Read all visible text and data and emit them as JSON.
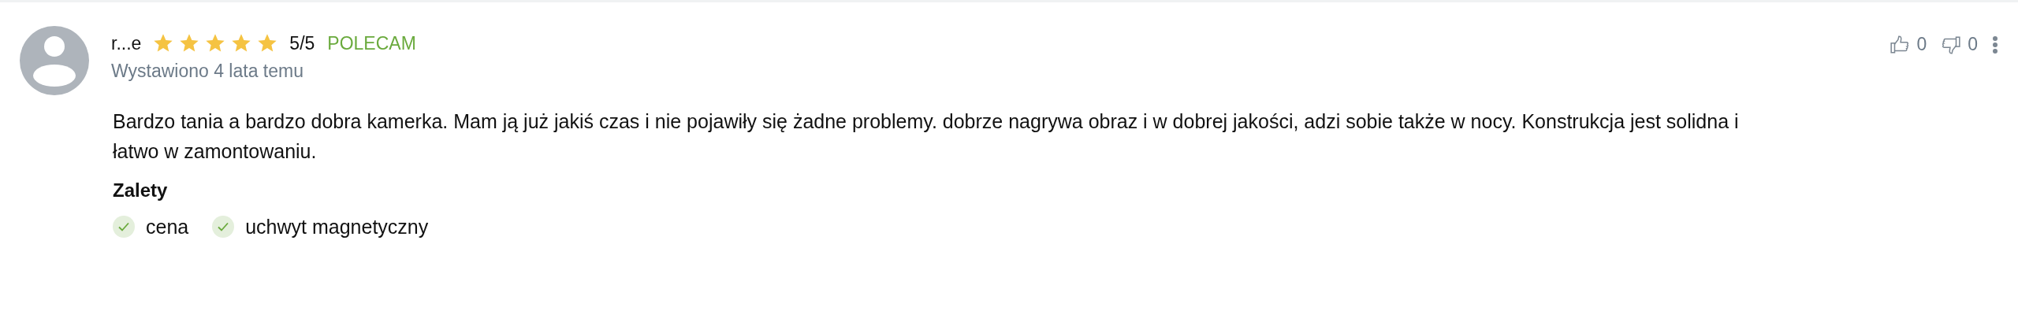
{
  "review": {
    "author": "r...e",
    "stars": 5,
    "score": "5/5",
    "recommendation": "POLECAM",
    "date": "Wystawiono 4 lata temu",
    "text": "Bardzo tania a bardzo dobra kamerka. Mam ją już jakiś czas i nie pojawiły się żadne problemy. dobrze nagrywa obraz i w dobrej jakości, adzi sobie także w nocy. Konstrukcja jest solidna i łatwo w zamontowaniu.",
    "pros_title": "Zalety",
    "pros": [
      "cena",
      "uchwyt magnetyczny"
    ],
    "likes": "0",
    "dislikes": "0"
  }
}
